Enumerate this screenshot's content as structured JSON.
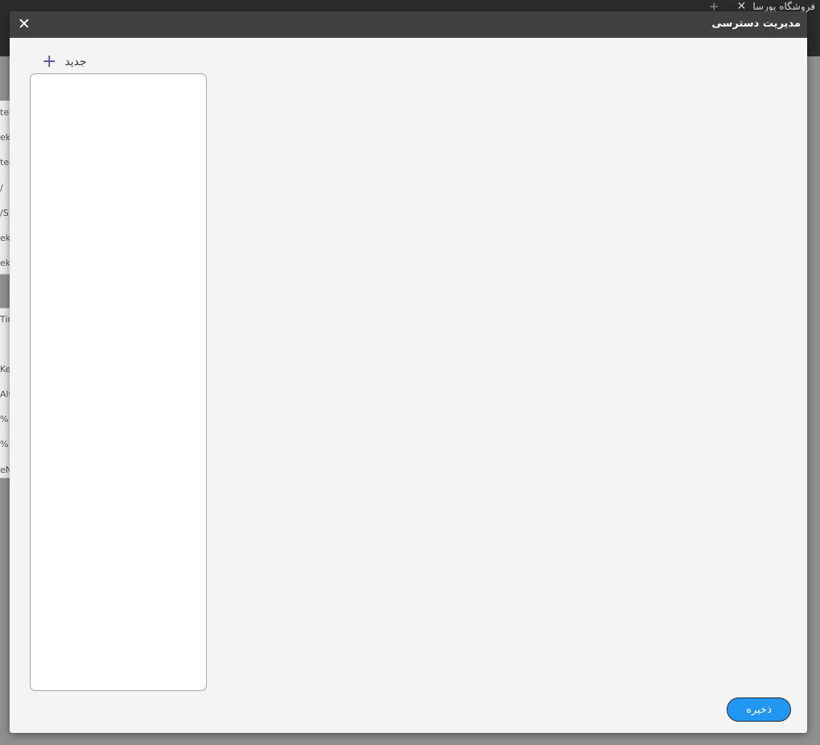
{
  "background": {
    "tab_title": "فروشگاه یورسا",
    "tab_close_icon": "close-icon",
    "tab_new_icon": "plus-icon",
    "side_fragments": [
      "te",
      "ek",
      "te",
      "/",
      "/S",
      "ek",
      "ek",
      "Tim",
      "Key",
      "Alt",
      "%",
      "%",
      "eN"
    ]
  },
  "dialog": {
    "title": "مدیریت دسترسی",
    "close_glyph": "✕",
    "new_button_label": "جدید",
    "new_button_icon": "plus-icon",
    "save_label": "ذخیره"
  },
  "colors": {
    "header_bg": "#404040",
    "save_button_bg": "#2196f3",
    "plus_icon": "#5a4ea0"
  }
}
